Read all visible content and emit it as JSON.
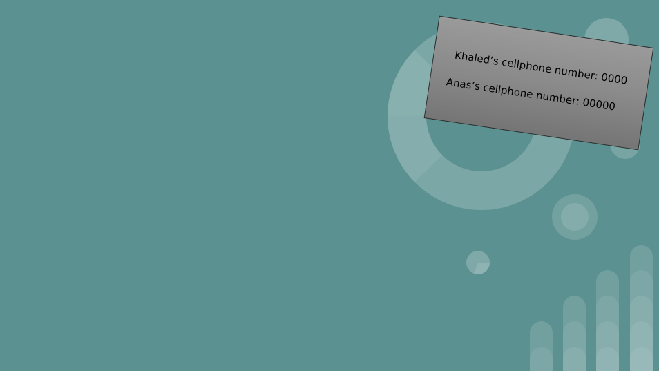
{
  "slide": {
    "background_color": "#5b9190",
    "note_card": {
      "line_1": "Khaled’s cellphone number: 0000",
      "line_2": "Anas’s cellphone number: 00000"
    }
  }
}
